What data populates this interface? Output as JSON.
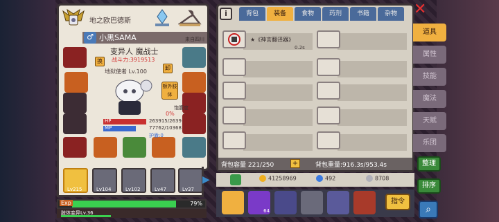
{
  "character": {
    "guild_name": "地之欧巴德斯",
    "player_name": "小黑SAMA",
    "origin": "来自四川",
    "class_title": "变异人 魔战士",
    "combat_power": "战斗力:3919513",
    "sub_title": "地狱使者 Lv.100",
    "swap_label": "换",
    "cut_label": "卸",
    "extra_body_label": "额外肢体",
    "satiety_label": "饱腹度",
    "satiety_value": "0%",
    "hp_label": "HP",
    "mp_label": "MP",
    "hp_text": "263915/2639",
    "mp_text": "77762/10368",
    "shield_text": "护盾:0",
    "hp_fraction": 1.0,
    "mp_fraction": 0.75
  },
  "companions": [
    {
      "label": "Lv215",
      "active": true
    },
    {
      "label": "Lv104",
      "active": false
    },
    {
      "label": "Lv102",
      "active": false
    },
    {
      "label": "Lv47",
      "active": false
    },
    {
      "label": "Lv37",
      "active": false
    }
  ],
  "exp": {
    "label": "Exp",
    "percent_text": "79%",
    "fraction": 0.79,
    "body_level_text": "肢体变异Lv.36",
    "level_fraction": 0.36
  },
  "inventory": {
    "tabs": [
      "背包",
      "装备",
      "食物",
      "药剂",
      "书籍",
      "杂物"
    ],
    "active_tab": 1,
    "item_name": "★《神言翻译器》",
    "item_time": "0.2s",
    "capacity_text": "背包容量 221/250",
    "weight_text": "背包重量:916.3s/953.4s",
    "plus_label": "+"
  },
  "side_tabs": [
    "道具",
    "属性",
    "技能",
    "魔法",
    "天赋",
    "乐团"
  ],
  "currency": {
    "gold": "41258969",
    "gems": "492",
    "silver": "8708"
  },
  "actions": {
    "command_label": "指令",
    "badge_count": "64",
    "sort_label": "整理",
    "order_label": "排序"
  }
}
